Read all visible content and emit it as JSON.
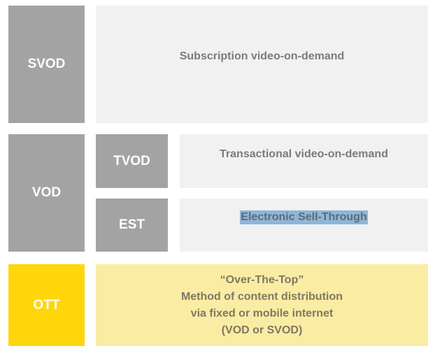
{
  "rows": {
    "svod": {
      "label": "SVOD",
      "description": "Subscription video-on-demand"
    },
    "vod": {
      "label": "VOD",
      "tvod": {
        "label": "TVOD",
        "description": "Transactional video-on-demand"
      },
      "est": {
        "label": "EST",
        "description": "Electronic Sell-Through"
      }
    },
    "ott": {
      "label": "OTT",
      "description_lines": [
        "“Over-The-Top”",
        "Method of content distribution",
        "via fixed or mobile internet",
        "(VOD or SVOD)"
      ]
    }
  },
  "colors": {
    "gray_dark": "#a3a3a3",
    "gray_light": "#f1f1f1",
    "yellow_dark": "#ffd60a",
    "yellow_light": "#fbeca3",
    "selection_highlight": "#8fb6d6"
  }
}
